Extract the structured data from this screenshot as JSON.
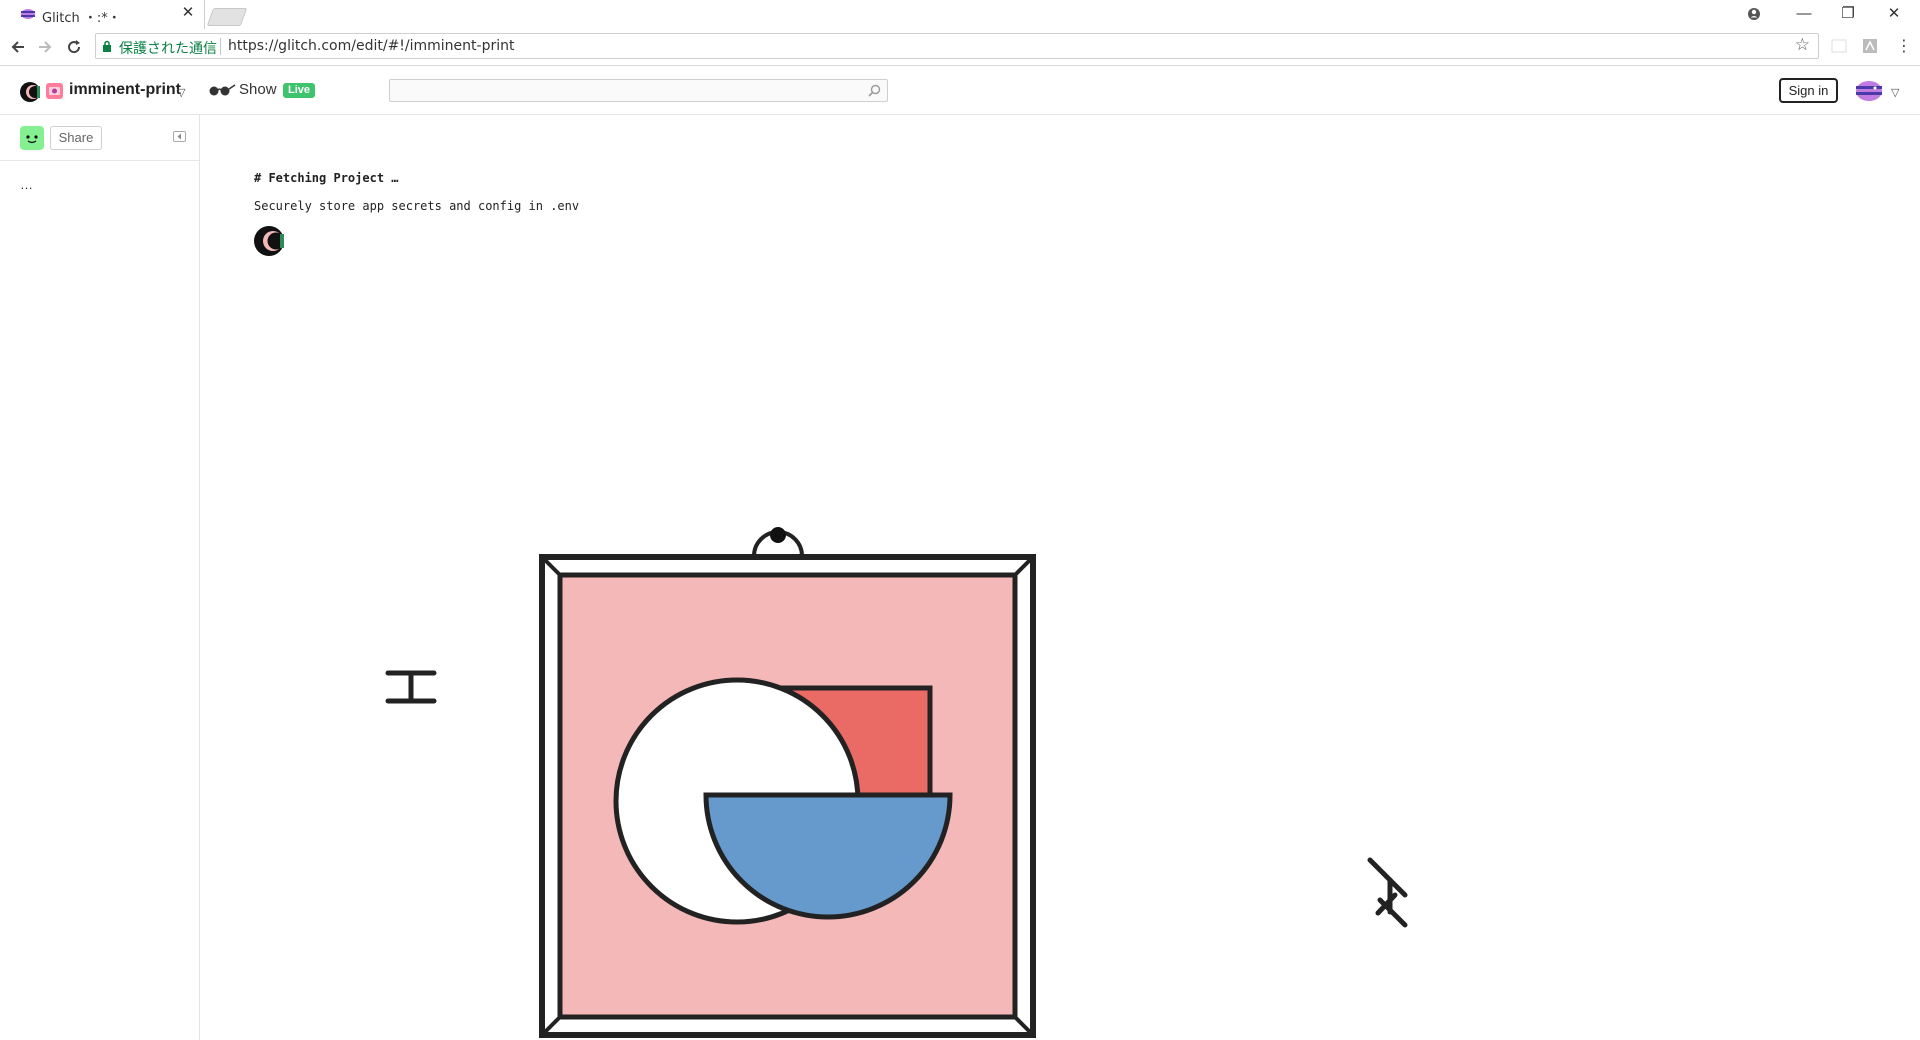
{
  "browser": {
    "tab_title": "Glitch ・:*・",
    "tab_close": "✕",
    "secure_label": "保護された通信",
    "url": "https://glitch.com/edit/#!/imminent-print",
    "controls": {
      "minimize": "—",
      "restore": "❐",
      "close": "✕"
    }
  },
  "header": {
    "project_name": "imminent-print",
    "show_label": "Show",
    "live_badge": "Live",
    "search_placeholder": "",
    "signin_label": "Sign in"
  },
  "sidebar": {
    "share_label": "Share",
    "ellipsis": "…"
  },
  "main": {
    "fetching_title": "# Fetching Project …",
    "fetching_subtitle": "Securely store app secrets and config in .env"
  },
  "colors": {
    "frame_bg": "#f4b8b8",
    "red_square": "#ea6b66",
    "blue_bowl": "#6699cc",
    "live_green": "#3ec46d",
    "secure_green": "#0b8043"
  }
}
